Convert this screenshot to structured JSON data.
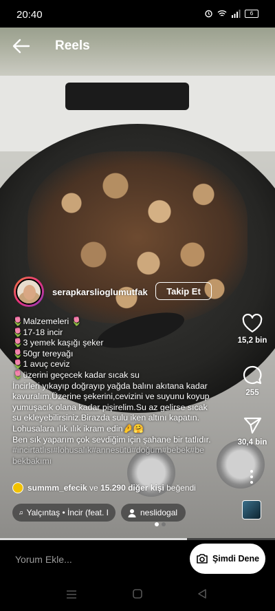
{
  "status": {
    "time": "20:40",
    "battery": "6"
  },
  "header": {
    "title": "Reels"
  },
  "profile": {
    "username": "serapkarslioglumutfak",
    "follow_label": "Takip Et"
  },
  "caption": {
    "lines": [
      {
        "text": "Malzemeleri ",
        "emoji": "tulip",
        "trail": "tulip"
      },
      {
        "text": "17-18 incir",
        "emoji": "tulip"
      },
      {
        "text": "3 yemek kaşığı şeker",
        "emoji": "tulip"
      },
      {
        "text": "50gr tereyağı",
        "emoji": "tulip"
      },
      {
        "text": "1 avuç ceviz",
        "emoji": "tulip"
      },
      {
        "text": "üzerini geçecek kadar sıcak su",
        "emoji": "tulip"
      }
    ],
    "para1": [
      " İncirleri yıkayıp doğrayıp yağda balını akıtana kadar",
      "kavuralım.Üzerine şekerini,cevizini ve suyunu koyup",
      "yumuşacık olana kadar pişirelim.Su az gelirse sıcak",
      "su ekleyebilirsiniz.Birazda sulu iken altını kapatın.",
      " Lohusalara ılık ılık ikram edin🤌🤗"
    ],
    "para2": "Ben sık yaparım çok sevdiğim için şahane bir tatlıdır.",
    "hashtags": [
      "#incirtatlısı#lohusalık#annesütü#doğum#bebek#be",
      "bekbakımı"
    ]
  },
  "actions": {
    "likes": "15,2 bin",
    "comments": "255",
    "shares": "30,4 bin"
  },
  "liked_by": {
    "user": "summm_efecik",
    "conj": " ve ",
    "others": "15.290 diğer kişi",
    "suffix": " beğendi"
  },
  "music": {
    "label": "Yalçıntaş • İncir (feat. I"
  },
  "tagged_user": {
    "label": "neslidogal"
  },
  "bottom": {
    "comment_placeholder": "Yorum Ekle...",
    "try_label": "Şimdi Dene"
  },
  "progress": 0.68
}
